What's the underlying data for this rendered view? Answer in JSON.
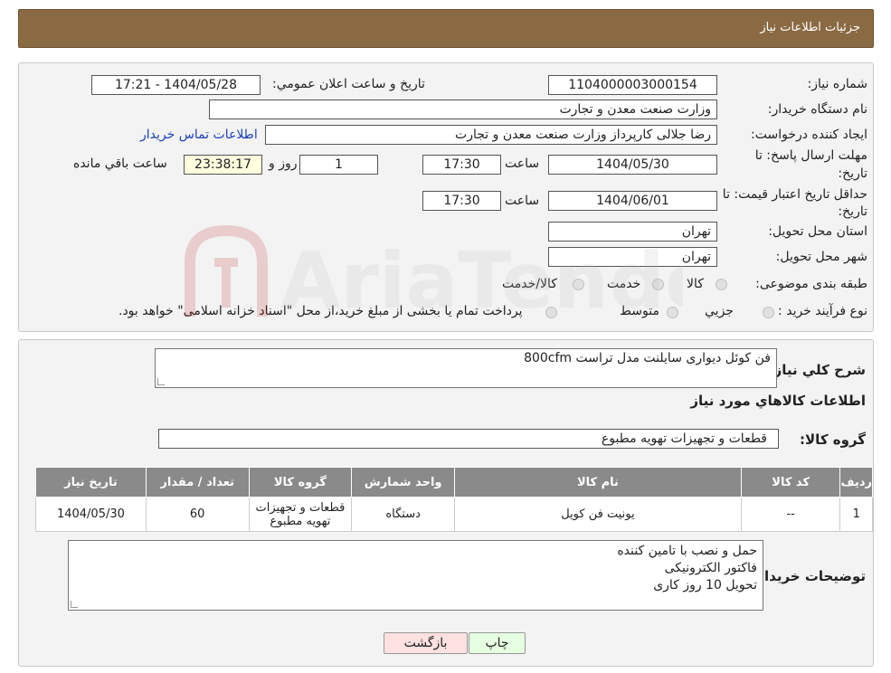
{
  "header": {
    "title": "جزئیات اطلاعات نیاز"
  },
  "form": {
    "need_number_label": "شماره نیاز:",
    "need_number": "1104000003000154",
    "announce_label": "تاریخ و ساعت اعلان عمومي:",
    "announce_value": "1404/05/28 - 17:21",
    "buyer_org_label": "نام دستگاه خريدار:",
    "buyer_org": "وزارت صنعت معدن و تجارت",
    "creator_label": "ايجاد كننده درخواست:",
    "creator": "رضا جلالی کارپرداز وزارت صنعت معدن و تجارت",
    "contact_link": "اطلاعات تماس خريدار",
    "reply_deadline_label_1": "مهلت ارسال پاسخ: تا",
    "reply_deadline_label_2": "تاريخ:",
    "reply_date": "1404/05/30",
    "time_label": "ساعت",
    "reply_time": "17:30",
    "days_value": "1",
    "days_label": "روز و",
    "remaining_time": "23:38:17",
    "remaining_label": "ساعت باقي مانده",
    "price_valid_label_1": "حداقل تاريخ اعتبار قيمت: تا",
    "price_valid_label_2": "تاريخ:",
    "price_valid_date": "1404/06/01",
    "price_valid_time": "17:30",
    "province_label": "استان محل تحويل:",
    "province": "تهران",
    "city_label": "شهر محل تحويل:",
    "city": "تهران",
    "category_label": "طبقه بندی موضوعی:",
    "category_options": [
      "كالا",
      "خدمت",
      "كالا/خدمت"
    ],
    "process_label": "نوع فرآيند خريد :",
    "process_options": [
      "جزيي",
      "متوسط"
    ],
    "process_note": "پرداخت تمام يا بخشی از مبلغ خريد،از محل \"اسناد خزانه اسلامی\" خواهد بود."
  },
  "details": {
    "description_label": "شرح كلي نياز:",
    "description": "فن کوئل دیواری سایلنت مدل تراست 800cfm",
    "goods_info_title": "اطلاعات كالاهاي مورد نياز",
    "goods_group_label": "گروه كالا:",
    "goods_group": "قطعات و تجهیزات تهویه مطبوع",
    "table": {
      "headers": [
        "رديف",
        "كد كالا",
        "نام كالا",
        "واحد شمارش",
        "گروه كالا",
        "تعداد / مقدار",
        "تاريخ نياز"
      ],
      "rows": [
        [
          "1",
          "--",
          "یونیت فن کویل",
          "دستگاه",
          "قطعات و تجهیزات تهویه مطبوع",
          "60",
          "1404/05/30"
        ]
      ]
    },
    "buyer_notes_label": "توضيحات خريدار:",
    "buyer_notes": [
      "حمل و نصب با تامین کننده",
      "فاکتور الکترونیکی",
      "تحویل 10 روز کاری"
    ]
  },
  "buttons": {
    "print": "چاپ",
    "back": "بازگشت"
  },
  "watermark_text": "AriaTender.neT"
}
